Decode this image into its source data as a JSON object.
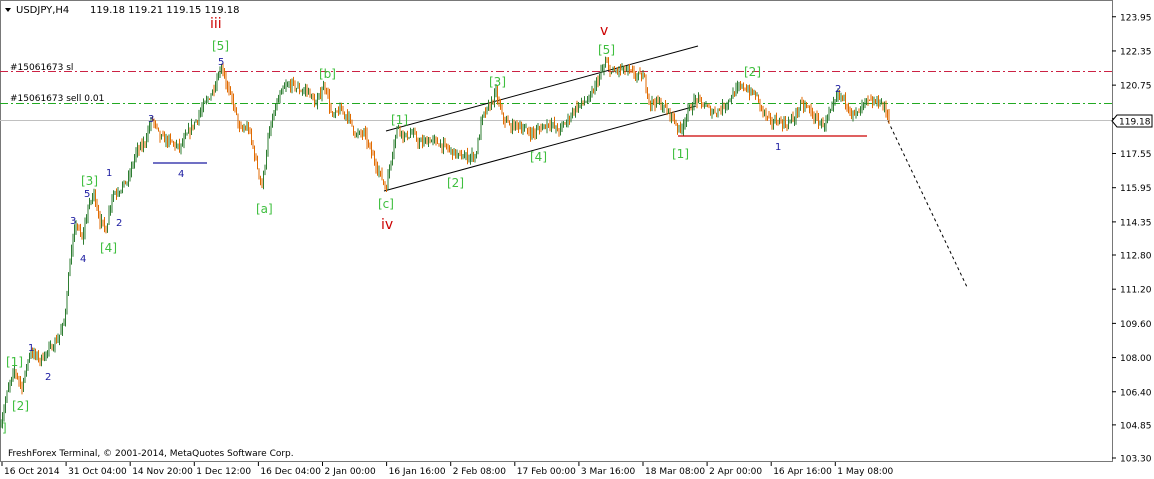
{
  "window": {
    "symbol_timeframe": "USDJPY,H4",
    "ohlc": "119.18 119.21 119.15 119.18",
    "copyright": "FreshForex Terminal, © 2001-2014, MetaQuotes Software Corp."
  },
  "colors": {
    "background": "#ffffff",
    "frame": "#787878",
    "bull_wick": "#2e7d32",
    "bear_wick": "#e06a00",
    "waves_green": "#3fbf3f",
    "waves_navy": "#1a1aa0",
    "waves_red": "#cc0000",
    "sl_line": "#cc2244",
    "sell_line": "#22aa22",
    "price_tag_bg": "#ffffff"
  },
  "chart_data": {
    "type": "candlestick",
    "symbol": "USDJPY",
    "timeframe": "H4",
    "ylim": [
      103.3,
      124.5
    ],
    "y_ticks": [
      "123.95",
      "122.35",
      "120.75",
      "119.18",
      "117.55",
      "115.95",
      "114.35",
      "112.80",
      "111.20",
      "109.60",
      "108.00",
      "106.40",
      "104.85",
      "103.30"
    ],
    "x_ticks": [
      "16 Oct 2014",
      "31 Oct 04:00",
      "14 Nov 20:00",
      "1 Dec 12:00",
      "16 Dec 04:00",
      "2 Jan 00:00",
      "16 Jan 16:00",
      "2 Feb 08:00",
      "17 Feb 00:00",
      "3 Mar 16:00",
      "18 Mar 08:00",
      "2 Apr 00:00",
      "16 Apr 16:00",
      "1 May 08:00"
    ],
    "current_price": "119.18",
    "price_path": [
      [
        0,
        104.8
      ],
      [
        8,
        106.5
      ],
      [
        15,
        107.4
      ],
      [
        22,
        106.6
      ],
      [
        30,
        108.3
      ],
      [
        40,
        107.9
      ],
      [
        50,
        108.4
      ],
      [
        58,
        108.9
      ],
      [
        64,
        109.6
      ],
      [
        70,
        112.5
      ],
      [
        76,
        114.3
      ],
      [
        82,
        113.5
      ],
      [
        88,
        115.0
      ],
      [
        94,
        115.7
      ],
      [
        100,
        114.4
      ],
      [
        106,
        114.0
      ],
      [
        112,
        115.6
      ],
      [
        120,
        115.9
      ],
      [
        128,
        116.3
      ],
      [
        136,
        117.6
      ],
      [
        144,
        118.0
      ],
      [
        152,
        119.2
      ],
      [
        160,
        118.3
      ],
      [
        170,
        118.1
      ],
      [
        180,
        117.8
      ],
      [
        188,
        118.5
      ],
      [
        196,
        119.1
      ],
      [
        204,
        119.8
      ],
      [
        212,
        120.4
      ],
      [
        218,
        121.2
      ],
      [
        222,
        121.7
      ],
      [
        228,
        120.5
      ],
      [
        234,
        119.8
      ],
      [
        240,
        118.6
      ],
      [
        248,
        118.8
      ],
      [
        255,
        117.4
      ],
      [
        262,
        116.0
      ],
      [
        268,
        118.2
      ],
      [
        276,
        119.8
      ],
      [
        284,
        120.6
      ],
      [
        292,
        120.8
      ],
      [
        300,
        120.5
      ],
      [
        308,
        120.5
      ],
      [
        316,
        119.8
      ],
      [
        322,
        120.6
      ],
      [
        326,
        120.7
      ],
      [
        332,
        119.2
      ],
      [
        340,
        119.6
      ],
      [
        348,
        119.3
      ],
      [
        356,
        118.4
      ],
      [
        364,
        118.5
      ],
      [
        372,
        117.5
      ],
      [
        380,
        116.6
      ],
      [
        386,
        115.9
      ],
      [
        392,
        117.6
      ],
      [
        398,
        118.9
      ],
      [
        404,
        118.3
      ],
      [
        412,
        118.5
      ],
      [
        420,
        118.0
      ],
      [
        430,
        118.2
      ],
      [
        440,
        118.0
      ],
      [
        450,
        117.7
      ],
      [
        460,
        117.4
      ],
      [
        470,
        117.4
      ],
      [
        476,
        117.5
      ],
      [
        482,
        119.2
      ],
      [
        490,
        119.8
      ],
      [
        496,
        120.4
      ],
      [
        502,
        119.3
      ],
      [
        510,
        118.8
      ],
      [
        518,
        118.9
      ],
      [
        526,
        118.6
      ],
      [
        534,
        118.5
      ],
      [
        542,
        118.8
      ],
      [
        550,
        119.0
      ],
      [
        558,
        118.6
      ],
      [
        566,
        119.0
      ],
      [
        574,
        119.6
      ],
      [
        582,
        119.9
      ],
      [
        590,
        120.1
      ],
      [
        596,
        120.8
      ],
      [
        600,
        121.2
      ],
      [
        606,
        121.8
      ],
      [
        612,
        121.3
      ],
      [
        620,
        121.5
      ],
      [
        628,
        121.4
      ],
      [
        636,
        121.2
      ],
      [
        644,
        121.1
      ],
      [
        650,
        119.9
      ],
      [
        656,
        120.0
      ],
      [
        664,
        119.7
      ],
      [
        672,
        119.3
      ],
      [
        680,
        118.6
      ],
      [
        688,
        119.5
      ],
      [
        696,
        120.1
      ],
      [
        704,
        119.8
      ],
      [
        712,
        119.5
      ],
      [
        720,
        119.6
      ],
      [
        728,
        120.0
      ],
      [
        736,
        120.5
      ],
      [
        744,
        120.7
      ],
      [
        750,
        120.4
      ],
      [
        756,
        120.3
      ],
      [
        762,
        119.6
      ],
      [
        770,
        119.0
      ],
      [
        778,
        119.1
      ],
      [
        786,
        118.9
      ],
      [
        794,
        119.2
      ],
      [
        800,
        119.8
      ],
      [
        808,
        119.7
      ],
      [
        816,
        119.1
      ],
      [
        824,
        118.9
      ],
      [
        832,
        119.6
      ],
      [
        838,
        120.3
      ],
      [
        846,
        120.0
      ],
      [
        852,
        119.4
      ],
      [
        858,
        119.4
      ],
      [
        866,
        120.0
      ],
      [
        872,
        119.9
      ],
      [
        880,
        120.0
      ],
      [
        885,
        119.6
      ],
      [
        890,
        119.18
      ]
    ],
    "annotations": {
      "sl_label": "#15061673 sl",
      "sell_label": "#15061673 sell 0.01",
      "green": [
        "[1]",
        "[2]",
        "[3]",
        "[4]",
        "[5]",
        "[a]",
        "[b]",
        "[c]",
        "[1]",
        "[2]",
        "[3]",
        "[4]",
        "[5]",
        "[1]",
        "[2]",
        "]"
      ],
      "navy": [
        "1",
        "2",
        "3",
        "4",
        "5",
        "1",
        "2",
        "3",
        "4",
        "5",
        "1",
        "2"
      ],
      "red": [
        "iii",
        "iv",
        "v"
      ]
    }
  }
}
